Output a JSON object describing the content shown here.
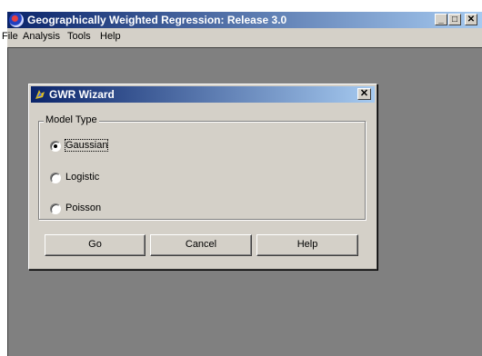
{
  "app": {
    "title": "Geographically Weighted Regression: Release 3.0",
    "window_controls": {
      "minimize": "_",
      "maximize": "□",
      "close": "✕"
    }
  },
  "menubar": {
    "items": [
      {
        "label": "File"
      },
      {
        "label": "Analysis"
      },
      {
        "label": "Tools"
      },
      {
        "label": "Help"
      }
    ]
  },
  "dialog": {
    "title": "GWR Wizard",
    "close": "✕",
    "group_label": "Model Type",
    "options": [
      {
        "label": "Gaussian",
        "selected": true
      },
      {
        "label": "Logistic",
        "selected": false
      },
      {
        "label": "Poisson",
        "selected": false
      }
    ],
    "buttons": {
      "go": "Go",
      "cancel": "Cancel",
      "help": "Help"
    }
  },
  "colors": {
    "titlebar_start": "#0a246a",
    "titlebar_end": "#a6caf0",
    "face": "#d4d0c8",
    "mdi_background": "#808080"
  }
}
